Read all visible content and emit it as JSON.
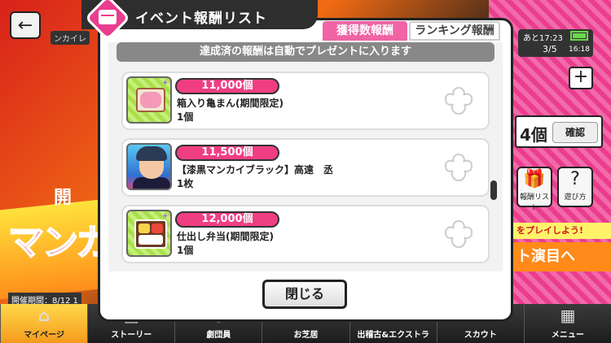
{
  "background": {
    "small_label": "ンカイレ",
    "banner_text": "マンガ",
    "banner_kai": "開",
    "timer_line1": "あと17:23",
    "timer_line2": "3/5",
    "clock": "16:18",
    "count": "4個",
    "confirm_label": "確認",
    "side_icons": [
      {
        "glyph": "🎁",
        "label": "報酬リスト"
      },
      {
        "glyph": "?",
        "label": "遊び方"
      }
    ],
    "play_banner": "をプレイしよう!",
    "goto_banner": "ト演目へ",
    "period": "開催期間：8/12 1"
  },
  "bottom_nav": [
    {
      "label": "マイページ",
      "glyph": "⌂"
    },
    {
      "label": "ストーリー",
      "glyph": "▤"
    },
    {
      "label": "劇団員",
      "glyph": "☺"
    },
    {
      "label": "お芝居",
      "glyph": "★"
    },
    {
      "label": "出稽古&エクストラ",
      "glyph": "⚑"
    },
    {
      "label": "スカウト",
      "glyph": "✦"
    },
    {
      "label": "メニュー",
      "glyph": "▦"
    }
  ],
  "modal": {
    "title": "イベント報酬リスト",
    "tabs": {
      "count": "獲得数報酬",
      "ranking": "ランキング報酬"
    },
    "notice": "達成済の報酬は自動でプレゼントに入ります",
    "rewards": [
      {
        "threshold": "11,000個",
        "name": "箱入り亀まん(期間限定)",
        "qty": "1個",
        "thumb": "food"
      },
      {
        "threshold": "11,500個",
        "name": "【漆黒マンカイブラック】高遠　丞",
        "qty": "1枚",
        "thumb": "card"
      },
      {
        "threshold": "12,000個",
        "name": "仕出し弁当(期間限定)",
        "qty": "1個",
        "thumb": "bento"
      }
    ],
    "close_label": "閉じる"
  },
  "colors": {
    "accent_pink": "#f03e83",
    "tab_active": "#f064a6",
    "header_dark": "#2e2e2e"
  }
}
